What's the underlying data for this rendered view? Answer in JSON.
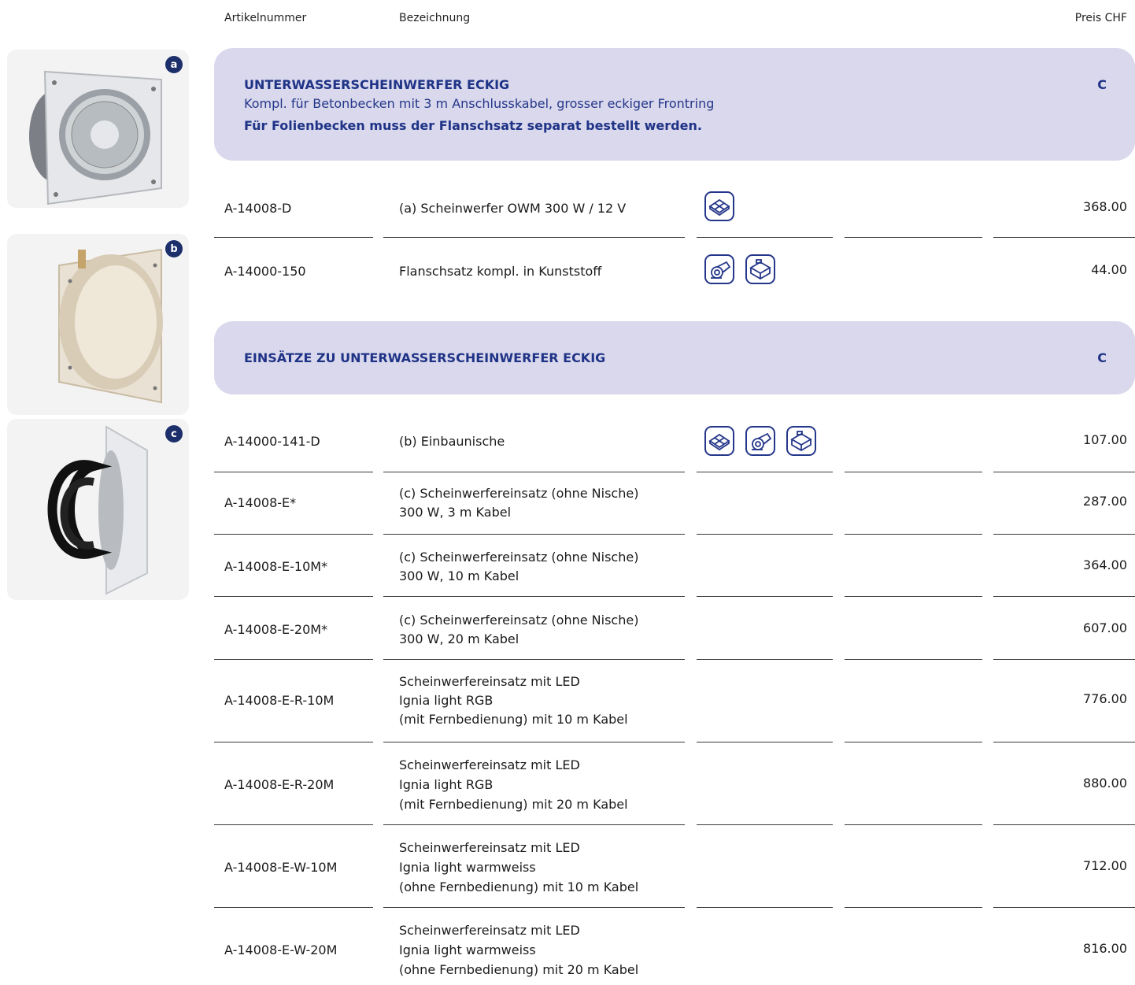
{
  "header": {
    "col_article": "Artikelnummer",
    "col_desc": "Bezeichnung",
    "col_price": "Preis CHF"
  },
  "images": [
    {
      "badge": "a"
    },
    {
      "badge": "b"
    },
    {
      "badge": "c"
    }
  ],
  "section1": {
    "title": "UNTERWASSERSCHEINWERFER ECKIG",
    "subtitle": "Kompl. für Betonbecken mit 3 m Anschlusskabel, grosser eckiger Frontring",
    "note": "Für Folienbecken muss der Flanschsatz separat bestellt werden.",
    "category": "C"
  },
  "section2": {
    "title": "EINSÄTZE ZU UNTERWASSERSCHEINWERFER ECKIG",
    "category": "C"
  },
  "rows1": [
    {
      "article": "A-14008-D",
      "desc": [
        "(a) Scheinwerfer OWM 300 W / 12 V"
      ],
      "icons": [
        "tile-icon"
      ],
      "price": "368.00"
    },
    {
      "article": "A-14000-150",
      "desc": [
        "Flanschsatz kompl. in Kunststoff"
      ],
      "icons": [
        "liner-roll-icon",
        "panel-pool-icon"
      ],
      "price": "44.00"
    }
  ],
  "rows2": [
    {
      "article": "A-14000-141-D",
      "desc": [
        "(b) Einbaunische"
      ],
      "icons": [
        "tile-icon",
        "liner-roll-icon",
        "panel-pool-icon"
      ],
      "price": "107.00"
    },
    {
      "article": "A-14008-E*",
      "desc": [
        "(c) Scheinwerfereinsatz (ohne Nische)",
        "300 W, 3 m Kabel"
      ],
      "icons": [],
      "price": "287.00"
    },
    {
      "article": "A-14008-E-10M*",
      "desc": [
        "(c) Scheinwerfereinsatz (ohne Nische)",
        "300 W, 10 m Kabel"
      ],
      "icons": [],
      "price": "364.00"
    },
    {
      "article": "A-14008-E-20M*",
      "desc": [
        "(c) Scheinwerfereinsatz (ohne Nische)",
        "300 W, 20 m Kabel"
      ],
      "icons": [],
      "price": "607.00"
    },
    {
      "article": "A-14008-E-R-10M",
      "desc": [
        "Scheinwerfereinsatz mit LED",
        "Ignia light RGB",
        "(mit Fernbedienung) mit 10 m Kabel"
      ],
      "icons": [],
      "price": "776.00"
    },
    {
      "article": "A-14008-E-R-20M",
      "desc": [
        "Scheinwerfereinsatz mit LED",
        "Ignia light RGB",
        "(mit Fernbedienung) mit 20 m Kabel"
      ],
      "icons": [],
      "price": "880.00"
    },
    {
      "article": "A-14008-E-W-10M",
      "desc": [
        "Scheinwerfereinsatz mit LED",
        "Ignia light warmweiss",
        "(ohne Fernbedienung) mit 10 m Kabel"
      ],
      "icons": [],
      "price": "712.00"
    },
    {
      "article": "A-14008-E-W-20M",
      "desc": [
        "Scheinwerfereinsatz mit LED",
        "Ignia light warmweiss",
        "(ohne Fernbedienung) mit 20 m Kabel"
      ],
      "icons": [],
      "price": "816.00"
    }
  ],
  "colors": {
    "banner_bg": "#d9d8ec",
    "brand_blue": "#1f3387",
    "badge_bg": "#1c2f6b"
  }
}
